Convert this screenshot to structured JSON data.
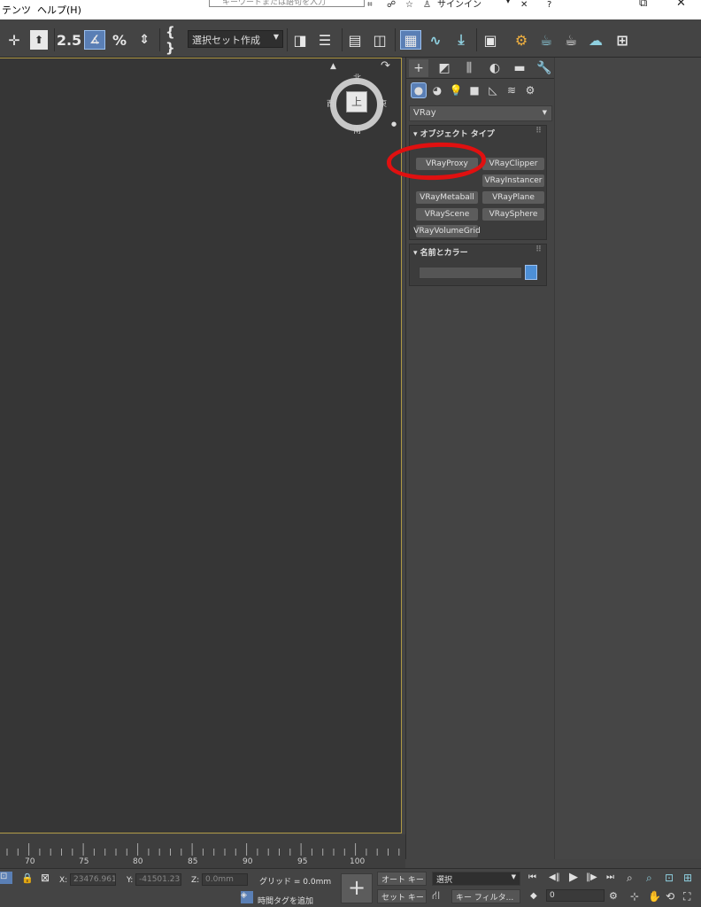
{
  "menubar": {
    "items": [
      "テンツ",
      "ヘルプ(H)"
    ],
    "search_placeholder": "キーワードまたは語句を入力",
    "signin_label": "サインイン"
  },
  "toolbar": {
    "snap_value": "2.5",
    "selection_set_label": "選択セット作成"
  },
  "viewcube": {
    "face": "上",
    "north": "北",
    "south": "南",
    "east": "東",
    "west": "西"
  },
  "command_panel": {
    "category": "VRay",
    "object_type_title": "オブジェクト タイプ",
    "object_buttons": [
      "VRayProxy",
      "VRayClipper",
      "VRayInstancer",
      "VRayMetaball",
      "VRayPlane",
      "VRayScene",
      "VRaySphere",
      "VRayVolumeGrid"
    ],
    "name_color_title": "名前とカラー",
    "annotation_color": "#e01010",
    "swatch_color": "#4d8fd6"
  },
  "timeline": {
    "ticks": [
      "70",
      "75",
      "80",
      "85",
      "90",
      "95",
      "100"
    ]
  },
  "statusbar": {
    "x_label": "X:",
    "x_value": "23476.961",
    "y_label": "Y:",
    "y_value": "-41501.23",
    "z_label": "Z:",
    "z_value": "0.0mm",
    "grid_label": "グリッド = 0.0mm",
    "time_tag_label": "時間タグを追加",
    "auto_key_label": "オート キー",
    "set_key_label": "セット キー",
    "selection_dropdown": "選択",
    "key_filter_label": "キー フィルタ...",
    "frame_value": "0"
  }
}
